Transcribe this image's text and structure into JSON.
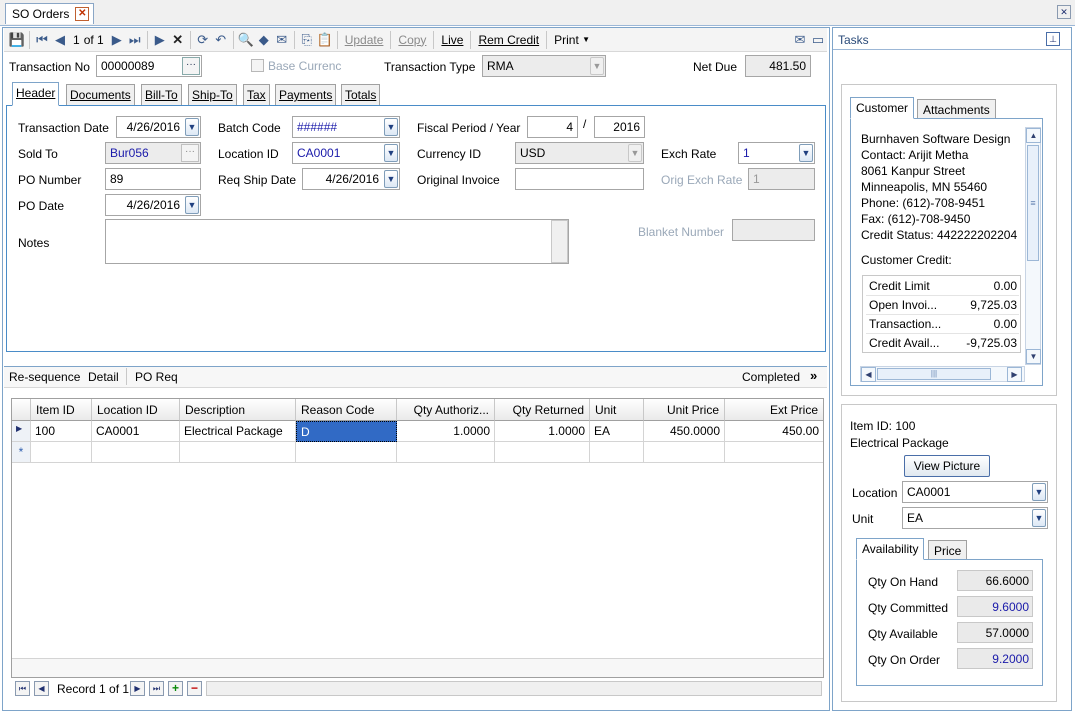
{
  "window": {
    "title": "SO Orders"
  },
  "toolbar": {
    "record": "1",
    "of": "of 1",
    "update": "Update",
    "copy": "Copy",
    "live": "Live",
    "rem_credit": "Rem Credit",
    "print": "Print"
  },
  "top": {
    "transaction_no_label": "Transaction No",
    "transaction_no": "00000089",
    "base_currency_label": "Base Currenc",
    "transaction_type_label": "Transaction Type",
    "transaction_type": "RMA",
    "net_due_label": "Net Due",
    "net_due": "481.50"
  },
  "tabs": [
    "Header",
    "Documents",
    "Bill-To",
    "Ship-To",
    "Tax",
    "Payments",
    "Totals"
  ],
  "header": {
    "transaction_date_label": "Transaction Date",
    "transaction_date": "4/26/2016",
    "batch_code_label": "Batch Code",
    "batch_code": "######",
    "fiscal_label": "Fiscal Period / Year",
    "fiscal_period": "4",
    "fiscal_slash": "/",
    "fiscal_year": "2016",
    "sold_to_label": "Sold To",
    "sold_to": "Bur056",
    "location_label": "Location ID",
    "location": "CA0001",
    "currency_label": "Currency ID",
    "currency": "USD",
    "exch_rate_label": "Exch Rate",
    "exch_rate": "1",
    "po_number_label": "PO Number",
    "po_number": "89",
    "req_ship_label": "Req Ship Date",
    "req_ship": "4/26/2016",
    "orig_invoice_label": "Original Invoice",
    "orig_invoice": "",
    "orig_exch_label": "Orig Exch Rate",
    "orig_exch": "1",
    "po_date_label": "PO Date",
    "po_date": "4/26/2016",
    "notes_label": "Notes",
    "notes": "",
    "blanket_label": "Blanket Number",
    "blanket": ""
  },
  "detail_bar": {
    "resequence": "Re-sequence",
    "detail": "Detail",
    "po_req": "PO Req",
    "completed": "Completed"
  },
  "grid": {
    "columns": [
      "Item ID",
      "Location ID",
      "Description",
      "Reason Code",
      "Qty Authoriz...",
      "Qty Returned",
      "Unit",
      "Unit Price",
      "Ext Price"
    ],
    "rows": [
      [
        "100",
        "CA0001",
        "Electrical Package",
        "D",
        "1.0000",
        "1.0000",
        "EA",
        "450.0000",
        "450.00"
      ]
    ],
    "new_row_marker": "*",
    "record_text": "Record 1 of 1"
  },
  "tasks": {
    "title": "Tasks",
    "customer_tabs": [
      "Customer",
      "Attachments"
    ],
    "customer_lines": [
      "Burnhaven Software Design",
      "Contact: Arijit Metha",
      "8061 Kanpur Street",
      "Minneapolis, MN 55460",
      "Phone: (612)-708-9451",
      "Fax: (612)-708-9450",
      "Credit Status: 442222202204"
    ],
    "credit_title": "Customer Credit:",
    "credit": [
      {
        "label": "Credit Limit",
        "value": "0.00"
      },
      {
        "label": "Open Invoi...",
        "value": "9,725.03"
      },
      {
        "label": "Transaction...",
        "value": "0.00"
      },
      {
        "label": "Credit Avail...",
        "value": "-9,725.03"
      }
    ],
    "item_id_line": "Item ID: 100",
    "item_desc": "Electrical Package",
    "view_picture": "View Picture",
    "location_label": "Location",
    "location": "CA0001",
    "unit_label": "Unit",
    "unit": "EA",
    "avail_tabs": [
      "Availability",
      "Price"
    ],
    "availability": [
      {
        "label": "Qty On Hand",
        "value": "66.6000"
      },
      {
        "label": "Qty Committed",
        "value": "9.6000"
      },
      {
        "label": "Qty Available",
        "value": "57.0000"
      },
      {
        "label": "Qty On Order",
        "value": "9.2000"
      }
    ]
  },
  "colors": {
    "accent": "#316ac5",
    "frame": "#7ea4c9",
    "link_blue": "#1a1aaa"
  }
}
